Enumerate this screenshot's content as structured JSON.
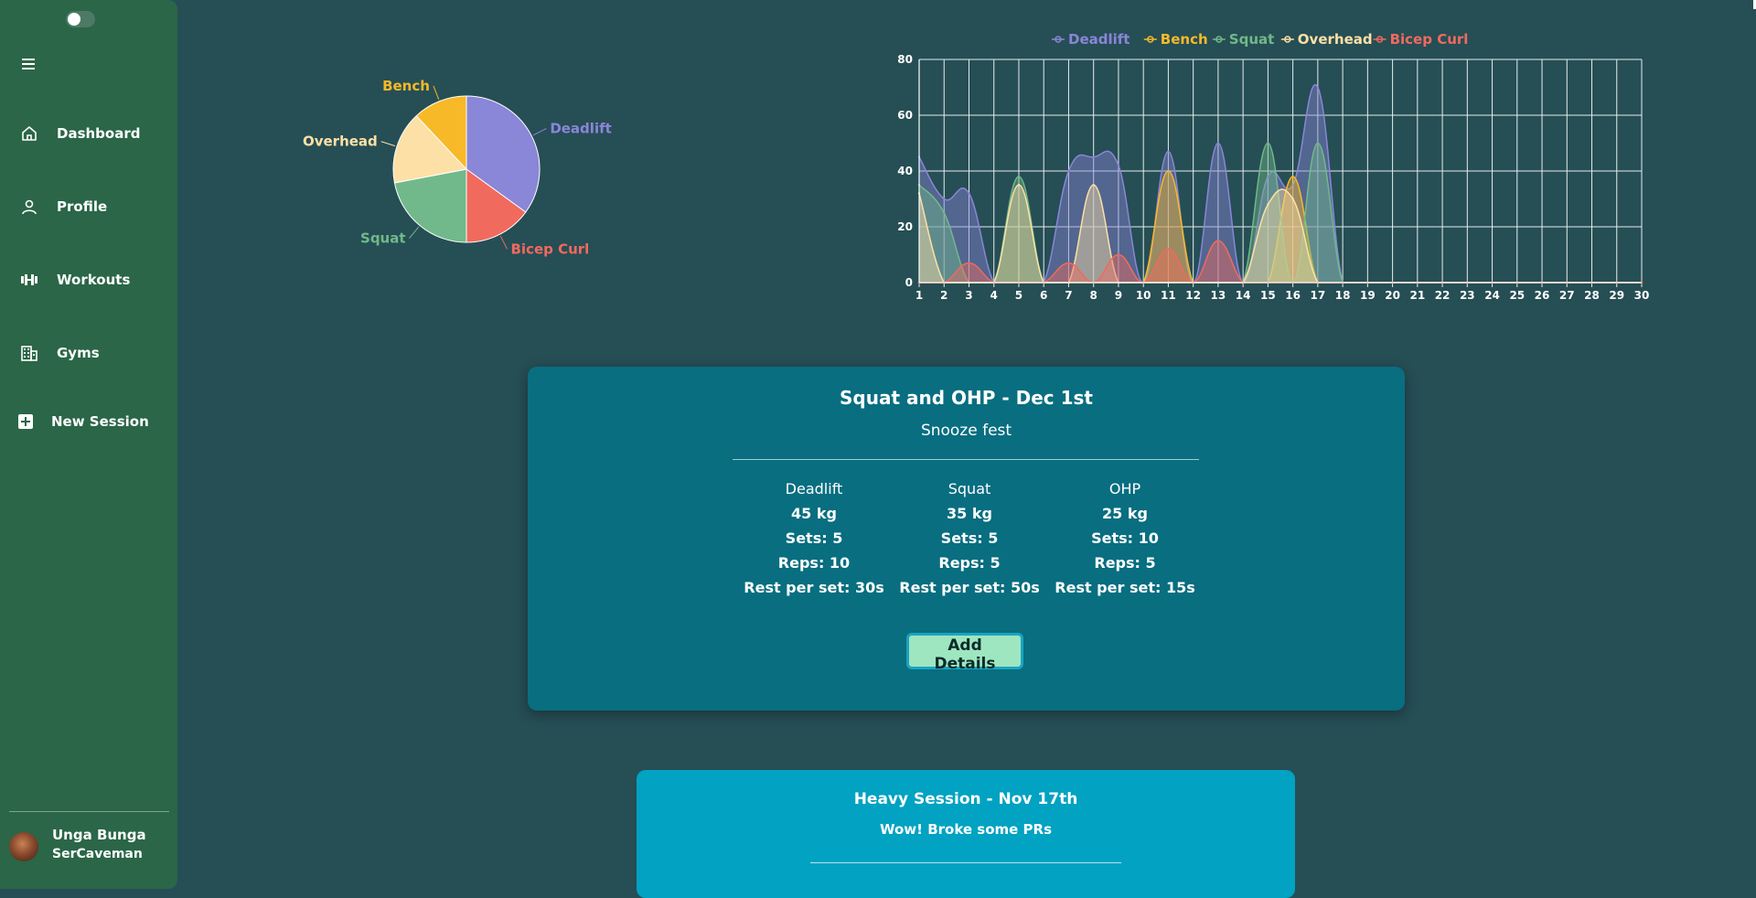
{
  "sidebar": {
    "items": [
      {
        "label": "Dashboard",
        "icon": "home-icon"
      },
      {
        "label": "Profile",
        "icon": "user-icon"
      },
      {
        "label": "Workouts",
        "icon": "dumbbell-icon"
      },
      {
        "label": "Gyms",
        "icon": "building-icon"
      },
      {
        "label": "New Session",
        "icon": "plus-square-icon"
      }
    ],
    "user": {
      "name": "Unga Bunga",
      "handle": "SerCaveman"
    }
  },
  "colors": {
    "background": "#264e55",
    "sidebar": "#2a6647",
    "deadlift": "#8a86d8",
    "bench": "#f7b928",
    "squat": "#71b98a",
    "overhead": "#fde0a6",
    "bicep_curl": "#f16a5e",
    "card_primary": "#086e80",
    "card_secondary": "#01a2c2",
    "button": "#9ee6c0"
  },
  "chart_data": [
    {
      "type": "pie",
      "categories": [
        "Deadlift",
        "Bicep Curl",
        "Squat",
        "Overhead",
        "Bench"
      ],
      "values": [
        35,
        15,
        22,
        16,
        12
      ],
      "colors": [
        "#8a86d8",
        "#f16a5e",
        "#71b98a",
        "#fde0a6",
        "#f7b928"
      ]
    },
    {
      "type": "area",
      "x": [
        1,
        2,
        3,
        4,
        5,
        6,
        7,
        8,
        9,
        10,
        11,
        12,
        13,
        14,
        15,
        16,
        17,
        18,
        19,
        20,
        21,
        22,
        23,
        24,
        25,
        26,
        27,
        28,
        29,
        30
      ],
      "ylim": [
        0,
        80
      ],
      "yticks": [
        0,
        20,
        40,
        60,
        80
      ],
      "legend_position": "top",
      "series": [
        {
          "name": "Deadlift",
          "color": "#8a86d8",
          "values": [
            45,
            30,
            32,
            0,
            0,
            0,
            40,
            45,
            42,
            0,
            47,
            0,
            50,
            0,
            38,
            35,
            70,
            0,
            0,
            0,
            0,
            0,
            0,
            0,
            0,
            0,
            0,
            0,
            0,
            0
          ]
        },
        {
          "name": "Bench",
          "color": "#f7b928",
          "values": [
            0,
            0,
            0,
            0,
            0,
            0,
            0,
            0,
            0,
            0,
            40,
            0,
            0,
            0,
            0,
            38,
            0,
            0,
            0,
            0,
            0,
            0,
            0,
            0,
            0,
            0,
            0,
            0,
            0,
            0
          ]
        },
        {
          "name": "Squat",
          "color": "#71b98a",
          "values": [
            35,
            25,
            0,
            0,
            38,
            0,
            0,
            0,
            0,
            0,
            0,
            0,
            0,
            0,
            50,
            0,
            50,
            0,
            0,
            0,
            0,
            0,
            0,
            0,
            0,
            0,
            0,
            0,
            0,
            0
          ]
        },
        {
          "name": "Overhead",
          "color": "#fde0a6",
          "values": [
            32,
            0,
            0,
            0,
            35,
            0,
            0,
            35,
            0,
            0,
            0,
            0,
            0,
            0,
            28,
            30,
            0,
            0,
            0,
            0,
            0,
            0,
            0,
            0,
            0,
            0,
            0,
            0,
            0,
            0
          ]
        },
        {
          "name": "Bicep Curl",
          "color": "#f16a5e",
          "values": [
            0,
            0,
            7,
            0,
            0,
            0,
            7,
            0,
            10,
            0,
            12,
            0,
            15,
            0,
            0,
            0,
            0,
            0,
            0,
            0,
            0,
            0,
            0,
            0,
            0,
            0,
            0,
            0,
            0,
            0
          ]
        }
      ]
    }
  ],
  "sessions": [
    {
      "title": "Squat and OHP - Dec 1st",
      "subtitle": "Snooze fest",
      "exercises": [
        {
          "name": "Deadlift",
          "weight": "45 kg",
          "sets": "Sets: 5",
          "reps": "Reps: 10",
          "rest": "Rest per set: 30s"
        },
        {
          "name": "Squat",
          "weight": "35 kg",
          "sets": "Sets: 5",
          "reps": "Reps: 5",
          "rest": "Rest per set: 50s"
        },
        {
          "name": "OHP",
          "weight": "25 kg",
          "sets": "Sets: 10",
          "reps": "Reps: 5",
          "rest": "Rest per set: 15s"
        }
      ],
      "button_label": "Add Details"
    },
    {
      "title": "Heavy Session - Nov 17th",
      "subtitle": "Wow! Broke some PRs"
    }
  ]
}
